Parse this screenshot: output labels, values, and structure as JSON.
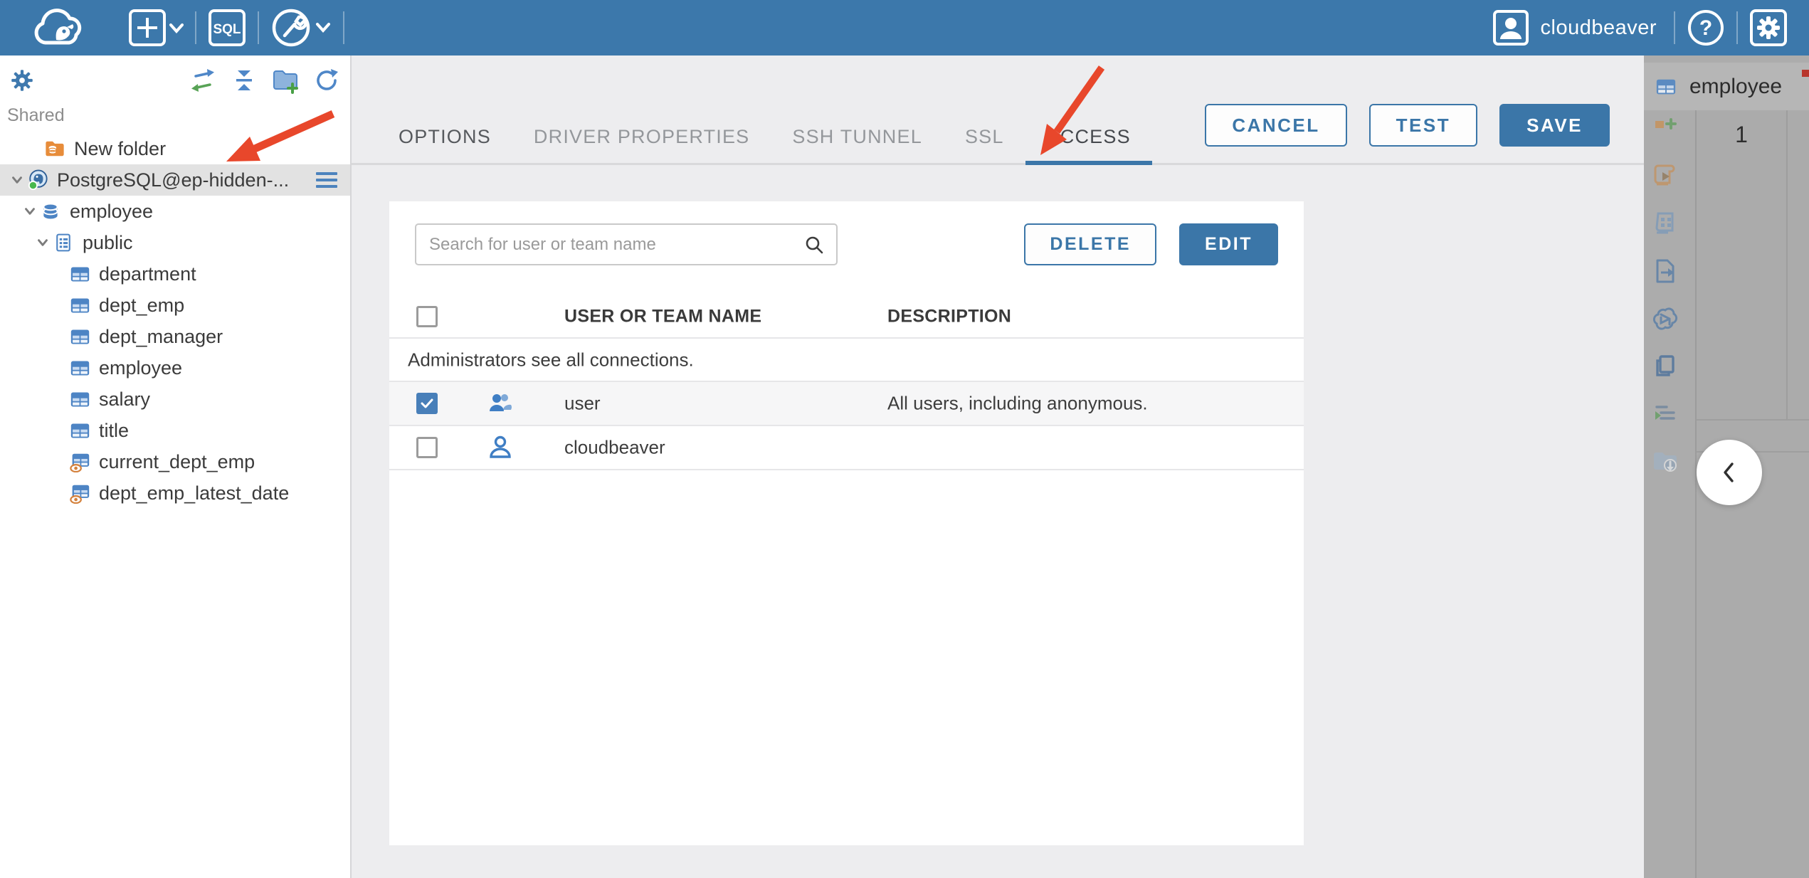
{
  "topbar": {
    "user_label": "cloudbeaver",
    "sql_label": "SQL"
  },
  "sidebar": {
    "section_label": "Shared",
    "tree": [
      {
        "label": "New folder",
        "icon": "folder-database"
      },
      {
        "label": "PostgreSQL@ep-hidden-...",
        "icon": "postgresql",
        "selected": true,
        "expanded": true
      },
      {
        "label": "employee",
        "icon": "database",
        "expanded": true
      },
      {
        "label": "public",
        "icon": "schema",
        "expanded": true
      },
      {
        "label": "department",
        "icon": "table"
      },
      {
        "label": "dept_emp",
        "icon": "table"
      },
      {
        "label": "dept_manager",
        "icon": "table"
      },
      {
        "label": "employee",
        "icon": "table"
      },
      {
        "label": "salary",
        "icon": "table"
      },
      {
        "label": "title",
        "icon": "table"
      },
      {
        "label": "current_dept_emp",
        "icon": "view"
      },
      {
        "label": "dept_emp_latest_date",
        "icon": "view"
      }
    ]
  },
  "dialog": {
    "tabs": [
      "OPTIONS",
      "DRIVER PROPERTIES",
      "SSH TUNNEL",
      "SSL",
      "ACCESS"
    ],
    "active_tab": "ACCESS",
    "actions": {
      "cancel": "CANCEL",
      "test": "TEST",
      "save": "SAVE"
    },
    "access": {
      "search_placeholder": "Search for user or team name",
      "delete_label": "DELETE",
      "edit_label": "EDIT",
      "columns": [
        "USER OR TEAM NAME",
        "DESCRIPTION"
      ],
      "note": "Administrators see all connections.",
      "rows": [
        {
          "name": "user",
          "description": "All users, including anonymous.",
          "checked": true,
          "type": "team"
        },
        {
          "name": "cloudbeaver",
          "description": "",
          "checked": false,
          "type": "user"
        }
      ]
    }
  },
  "right_panel": {
    "tab_label": "employee",
    "row_number": "1"
  },
  "colors": {
    "topbar_blue": "#3c78ab",
    "accent_blue": "#3b76a8",
    "checkbox_blue": "#487fb9",
    "annotation_red": "#e8472b",
    "selected_row_gray": "#e2e2e2",
    "highlight_row": "#f6f6f7"
  }
}
